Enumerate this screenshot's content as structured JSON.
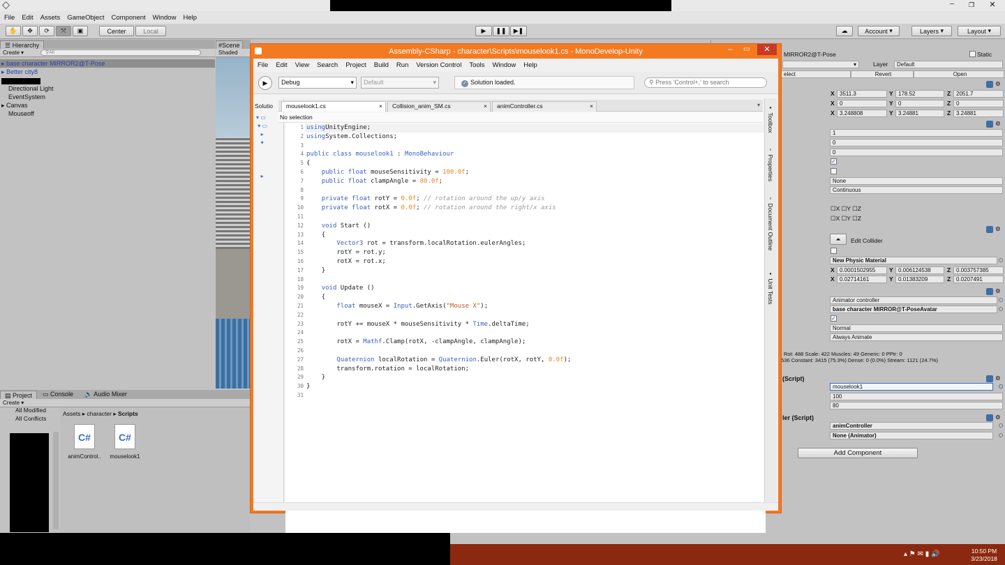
{
  "unity": {
    "menu": [
      "File",
      "Edit",
      "Assets",
      "GameObject",
      "Component",
      "Window",
      "Help"
    ],
    "toolbar": {
      "center": "Center",
      "local": "Local",
      "account": "Account",
      "layers": "Layers",
      "layout": "Layout"
    },
    "hierarchy": {
      "tab": "Hierarchy",
      "create": "Create",
      "search_placeholder": "All",
      "items": [
        "base character MIRROR2@T-Pose",
        "Better city8",
        "Directional Light",
        "EventSystem",
        "Canvas",
        "Mouseoff"
      ]
    },
    "scene": {
      "tab": "Scene",
      "mode": "Shaded"
    },
    "project": {
      "tabs": [
        "Project",
        "Console",
        "Audio Mixer"
      ],
      "create": "Create",
      "left_items": [
        "All Modified",
        "All Conflicts"
      ],
      "breadcrumb": [
        "Assets",
        "character",
        "Scripts"
      ],
      "files": [
        "animControl..",
        "mouselook1"
      ]
    },
    "inspector": {
      "object_name": "MIRROR2@T-Pose",
      "static": "Static",
      "layer_label": "Layer",
      "layer_value": "Default",
      "prefab_buttons": [
        "elect",
        "Revert",
        "Open"
      ],
      "transform_rows": [
        [
          "3511.3",
          "178.52",
          "2051.7"
        ],
        [
          "0",
          "0",
          "0"
        ],
        [
          "3.248808",
          "3.24881",
          "3.24881"
        ]
      ],
      "rb_values": [
        "1",
        "0",
        "0"
      ],
      "rb_interp": "None",
      "rb_collision": "Continuous",
      "constraints_axes": [
        "X",
        "Y",
        "Z"
      ],
      "edit_collider": "Edit Collider",
      "material": "New Physic Material",
      "center_row": [
        "0.0001502955",
        "0.006124538",
        "0.003757385"
      ],
      "size_row": [
        "0.02714161",
        "0.01383209",
        "0.0207491"
      ],
      "animator_controller": "Animator controller",
      "avatar": "base character MIRROR@T-PoseAvatar",
      "update_mode": "Normal",
      "culling_mode": "Always Animate",
      "anim_stats": [
        "Rot: 488 Scale: 422 Muscles: 49 Generic: 0 PPtr: 0",
        "536 Constant: 3415 (75.3%) Dense: 0 (0.0%) Stream: 1121 (24.7%)"
      ],
      "script1_title": "(Script)",
      "script1_file": "mouselook1",
      "script1_values": [
        "100",
        "80"
      ],
      "script2_title": "ler (Script)",
      "script2_file": "animController",
      "script2_anim": "None (Animator)",
      "add_component": "Add Component"
    }
  },
  "monodevelop": {
    "title": "Assembly-CSharp - character\\Scripts\\mouselook1.cs - MonoDevelop-Unity",
    "menu": [
      "File",
      "Edit",
      "View",
      "Search",
      "Project",
      "Build",
      "Run",
      "Version Control",
      "Tools",
      "Window",
      "Help"
    ],
    "config": "Debug",
    "platform": "Default",
    "status": "Solution loaded.",
    "search_placeholder": "Press 'Control+,' to search",
    "solution_label": "Solutio",
    "tabs": [
      "mouselook1.cs",
      "Collision_anim_SM.cs",
      "animController.cs"
    ],
    "nav": "No selection",
    "side_pads": [
      "Toolbox",
      "Properties",
      "Document Outline",
      "Unit Tests"
    ],
    "code": [
      [
        [
          "kw",
          "using"
        ],
        [
          "",
          "UnityEngine;"
        ]
      ],
      [
        [
          "kw",
          "using"
        ],
        [
          "",
          "System.Collections;"
        ]
      ],
      [],
      [
        [
          "kw",
          "public class"
        ],
        [
          "ty",
          " mouselook1"
        ],
        [
          "",
          " : "
        ],
        [
          "ty",
          "MonoBehaviour"
        ]
      ],
      [
        [
          "",
          "{"
        ]
      ],
      [
        [
          "",
          "    "
        ],
        [
          "kw",
          "public float"
        ],
        [
          "",
          " mouseSensitivity = "
        ],
        [
          "num",
          "100.0f"
        ],
        [
          "",
          ";"
        ]
      ],
      [
        [
          "",
          "    "
        ],
        [
          "kw",
          "public float"
        ],
        [
          "",
          " clampAngle = "
        ],
        [
          "num",
          "80.0f"
        ],
        [
          "",
          ";"
        ]
      ],
      [],
      [
        [
          "",
          "    "
        ],
        [
          "kw",
          "private float"
        ],
        [
          "",
          " rotY = "
        ],
        [
          "num",
          "0.0f"
        ],
        [
          "",
          "; "
        ],
        [
          "cm",
          "// rotation around the up/y axis"
        ]
      ],
      [
        [
          "",
          "    "
        ],
        [
          "kw",
          "private float"
        ],
        [
          "",
          " rotX = "
        ],
        [
          "num",
          "0.0f"
        ],
        [
          "",
          "; "
        ],
        [
          "cm",
          "// rotation around the right/x axis"
        ]
      ],
      [],
      [
        [
          "",
          "    "
        ],
        [
          "kw",
          "void"
        ],
        [
          "",
          " Start ()"
        ]
      ],
      [
        [
          "",
          "    {"
        ]
      ],
      [
        [
          "",
          "        "
        ],
        [
          "ty",
          "Vector3"
        ],
        [
          "",
          " rot = transform.localRotation.eulerAngles;"
        ]
      ],
      [
        [
          "",
          "        rotY = rot.y;"
        ]
      ],
      [
        [
          "",
          "        rotX = rot.x;"
        ]
      ],
      [
        [
          "",
          "    }"
        ]
      ],
      [],
      [
        [
          "",
          "    "
        ],
        [
          "kw",
          "void"
        ],
        [
          "",
          " Update ()"
        ]
      ],
      [
        [
          "",
          "    {"
        ]
      ],
      [
        [
          "",
          "        "
        ],
        [
          "kw",
          "float"
        ],
        [
          "",
          " mouseX = "
        ],
        [
          "ty",
          "Input"
        ],
        [
          "",
          ".GetAxis("
        ],
        [
          "str",
          "\"Mouse X\""
        ],
        [
          "",
          ");"
        ]
      ],
      [],
      [
        [
          "",
          "        rotY += mouseX * mouseSensitivity * "
        ],
        [
          "ty",
          "Time"
        ],
        [
          "",
          ".deltaTime;"
        ]
      ],
      [],
      [
        [
          "",
          "        rotX = "
        ],
        [
          "ty",
          "Mathf"
        ],
        [
          "",
          ".Clamp(rotX, -clampAngle, clampAngle);"
        ]
      ],
      [],
      [
        [
          "",
          "        "
        ],
        [
          "ty",
          "Quaternion"
        ],
        [
          "",
          " localRotation = "
        ],
        [
          "ty",
          "Quaternion"
        ],
        [
          "",
          ".Euler(rotX, rotY, "
        ],
        [
          "num",
          "0.0f"
        ],
        [
          "",
          ");"
        ]
      ],
      [
        [
          "",
          "        transform.rotation = localRotation;"
        ]
      ],
      [
        [
          "",
          "    }"
        ]
      ],
      [
        [
          "",
          "}"
        ]
      ],
      []
    ]
  },
  "taskbar": {
    "time": "10:50 PM",
    "date": "3/23/2018"
  }
}
